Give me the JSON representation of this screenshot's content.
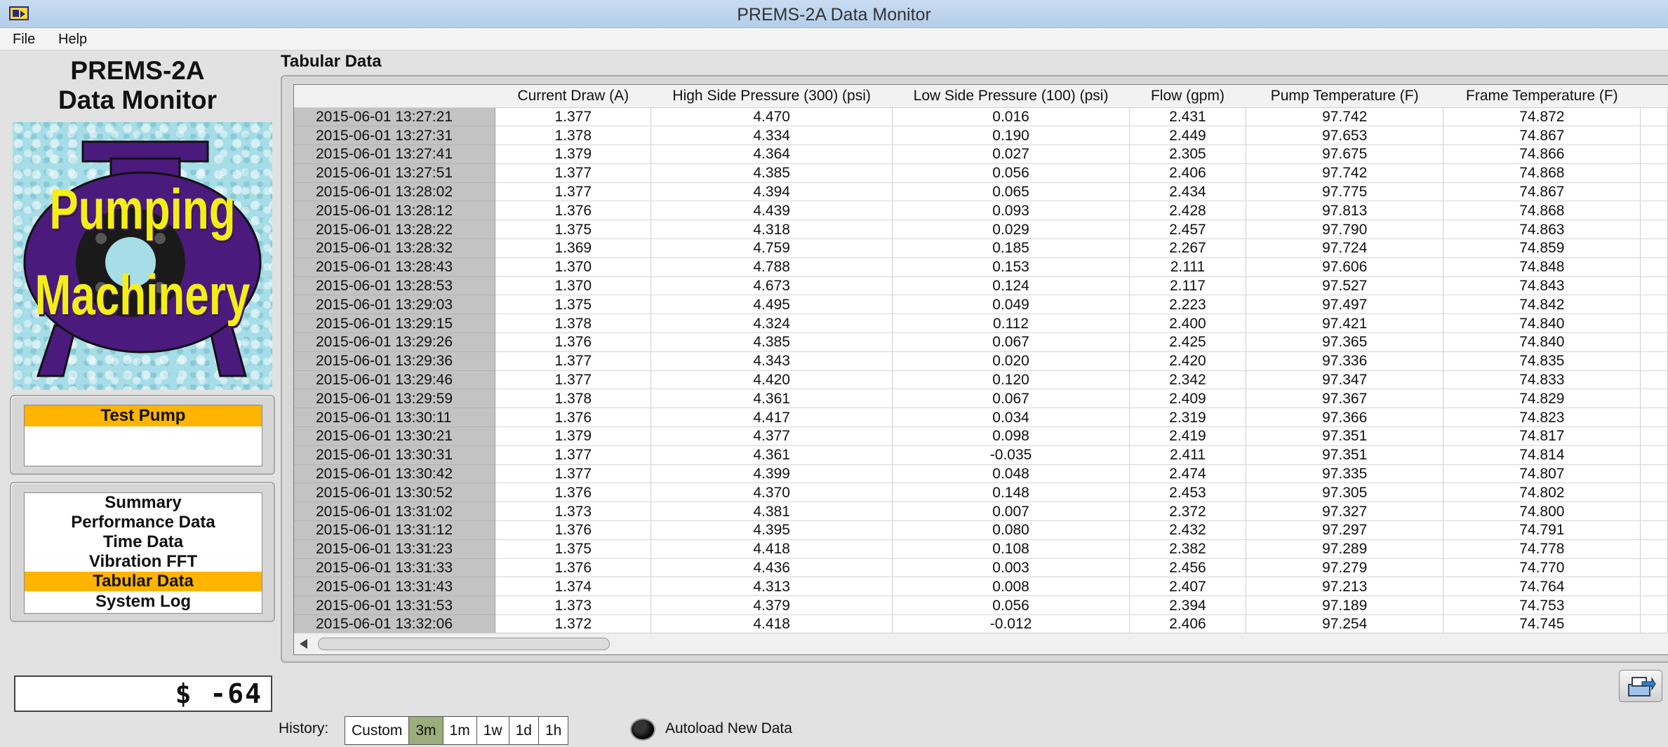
{
  "window": {
    "title": "PREMS-2A Data Monitor"
  },
  "menu": {
    "items": [
      "File",
      "Help"
    ]
  },
  "left_panel": {
    "title_line1": "PREMS-2A",
    "title_line2": "Data Monitor",
    "logo": {
      "line1": "Pumping",
      "line2": "Machinery",
      "icon": "pump-logo-icon"
    },
    "pump_box": {
      "title": "Test Pump",
      "value": ""
    },
    "nav": {
      "items": [
        "Summary",
        "Performance Data",
        "Time Data",
        "Vibration FFT",
        "Tabular Data",
        "System Log"
      ],
      "active": "Tabular Data"
    },
    "value_display": "$ -64"
  },
  "colors": {
    "accent": "#ffb400",
    "selected_history": "#9aad7b",
    "logo_purple": "#4b1a7d",
    "logo_text": "#f4ee18"
  },
  "table": {
    "section_title": "Tabular Data",
    "columns": [
      "Current Draw (A)",
      "High Side Pressure (300) (psi)",
      "Low Side Pressure (100) (psi)",
      "Flow (gpm)",
      "Pump Temperature (F)",
      "Frame Temperature (F)"
    ],
    "rows": [
      [
        "2015-06-01 13:27:21",
        "1.377",
        "4.470",
        "0.016",
        "2.431",
        "97.742",
        "74.872"
      ],
      [
        "2015-06-01 13:27:31",
        "1.378",
        "4.334",
        "0.190",
        "2.449",
        "97.653",
        "74.867"
      ],
      [
        "2015-06-01 13:27:41",
        "1.379",
        "4.364",
        "0.027",
        "2.305",
        "97.675",
        "74.866"
      ],
      [
        "2015-06-01 13:27:51",
        "1.377",
        "4.385",
        "0.056",
        "2.406",
        "97.742",
        "74.868"
      ],
      [
        "2015-06-01 13:28:02",
        "1.377",
        "4.394",
        "0.065",
        "2.434",
        "97.775",
        "74.867"
      ],
      [
        "2015-06-01 13:28:12",
        "1.376",
        "4.439",
        "0.093",
        "2.428",
        "97.813",
        "74.868"
      ],
      [
        "2015-06-01 13:28:22",
        "1.375",
        "4.318",
        "0.029",
        "2.457",
        "97.790",
        "74.863"
      ],
      [
        "2015-06-01 13:28:32",
        "1.369",
        "4.759",
        "0.185",
        "2.267",
        "97.724",
        "74.859"
      ],
      [
        "2015-06-01 13:28:43",
        "1.370",
        "4.788",
        "0.153",
        "2.111",
        "97.606",
        "74.848"
      ],
      [
        "2015-06-01 13:28:53",
        "1.370",
        "4.673",
        "0.124",
        "2.117",
        "97.527",
        "74.843"
      ],
      [
        "2015-06-01 13:29:03",
        "1.375",
        "4.495",
        "0.049",
        "2.223",
        "97.497",
        "74.842"
      ],
      [
        "2015-06-01 13:29:15",
        "1.378",
        "4.324",
        "0.112",
        "2.400",
        "97.421",
        "74.840"
      ],
      [
        "2015-06-01 13:29:26",
        "1.376",
        "4.385",
        "0.067",
        "2.425",
        "97.365",
        "74.840"
      ],
      [
        "2015-06-01 13:29:36",
        "1.377",
        "4.343",
        "0.020",
        "2.420",
        "97.336",
        "74.835"
      ],
      [
        "2015-06-01 13:29:46",
        "1.377",
        "4.420",
        "0.120",
        "2.342",
        "97.347",
        "74.833"
      ],
      [
        "2015-06-01 13:29:59",
        "1.378",
        "4.361",
        "0.067",
        "2.409",
        "97.367",
        "74.829"
      ],
      [
        "2015-06-01 13:30:11",
        "1.376",
        "4.417",
        "0.034",
        "2.319",
        "97.366",
        "74.823"
      ],
      [
        "2015-06-01 13:30:21",
        "1.379",
        "4.377",
        "0.098",
        "2.419",
        "97.351",
        "74.817"
      ],
      [
        "2015-06-01 13:30:31",
        "1.377",
        "4.361",
        "-0.035",
        "2.411",
        "97.351",
        "74.814"
      ],
      [
        "2015-06-01 13:30:42",
        "1.377",
        "4.399",
        "0.048",
        "2.474",
        "97.335",
        "74.807"
      ],
      [
        "2015-06-01 13:30:52",
        "1.376",
        "4.370",
        "0.148",
        "2.453",
        "97.305",
        "74.802"
      ],
      [
        "2015-06-01 13:31:02",
        "1.373",
        "4.381",
        "0.007",
        "2.372",
        "97.327",
        "74.800"
      ],
      [
        "2015-06-01 13:31:12",
        "1.376",
        "4.395",
        "0.080",
        "2.432",
        "97.297",
        "74.791"
      ],
      [
        "2015-06-01 13:31:23",
        "1.375",
        "4.418",
        "0.108",
        "2.382",
        "97.289",
        "74.778"
      ],
      [
        "2015-06-01 13:31:33",
        "1.376",
        "4.436",
        "0.003",
        "2.456",
        "97.279",
        "74.770"
      ],
      [
        "2015-06-01 13:31:43",
        "1.374",
        "4.313",
        "0.008",
        "2.407",
        "97.213",
        "74.764"
      ],
      [
        "2015-06-01 13:31:53",
        "1.373",
        "4.379",
        "0.056",
        "2.394",
        "97.189",
        "74.753"
      ],
      [
        "2015-06-01 13:32:06",
        "1.372",
        "4.418",
        "-0.012",
        "2.406",
        "97.254",
        "74.745"
      ]
    ]
  },
  "export_button": {
    "icon": "export-icon"
  },
  "history": {
    "label": "History:",
    "options": [
      "Custom",
      "3m",
      "1m",
      "1w",
      "1d",
      "1h"
    ],
    "selected": "3m"
  },
  "autoload": {
    "label": "Autoload New Data",
    "state": "off"
  }
}
